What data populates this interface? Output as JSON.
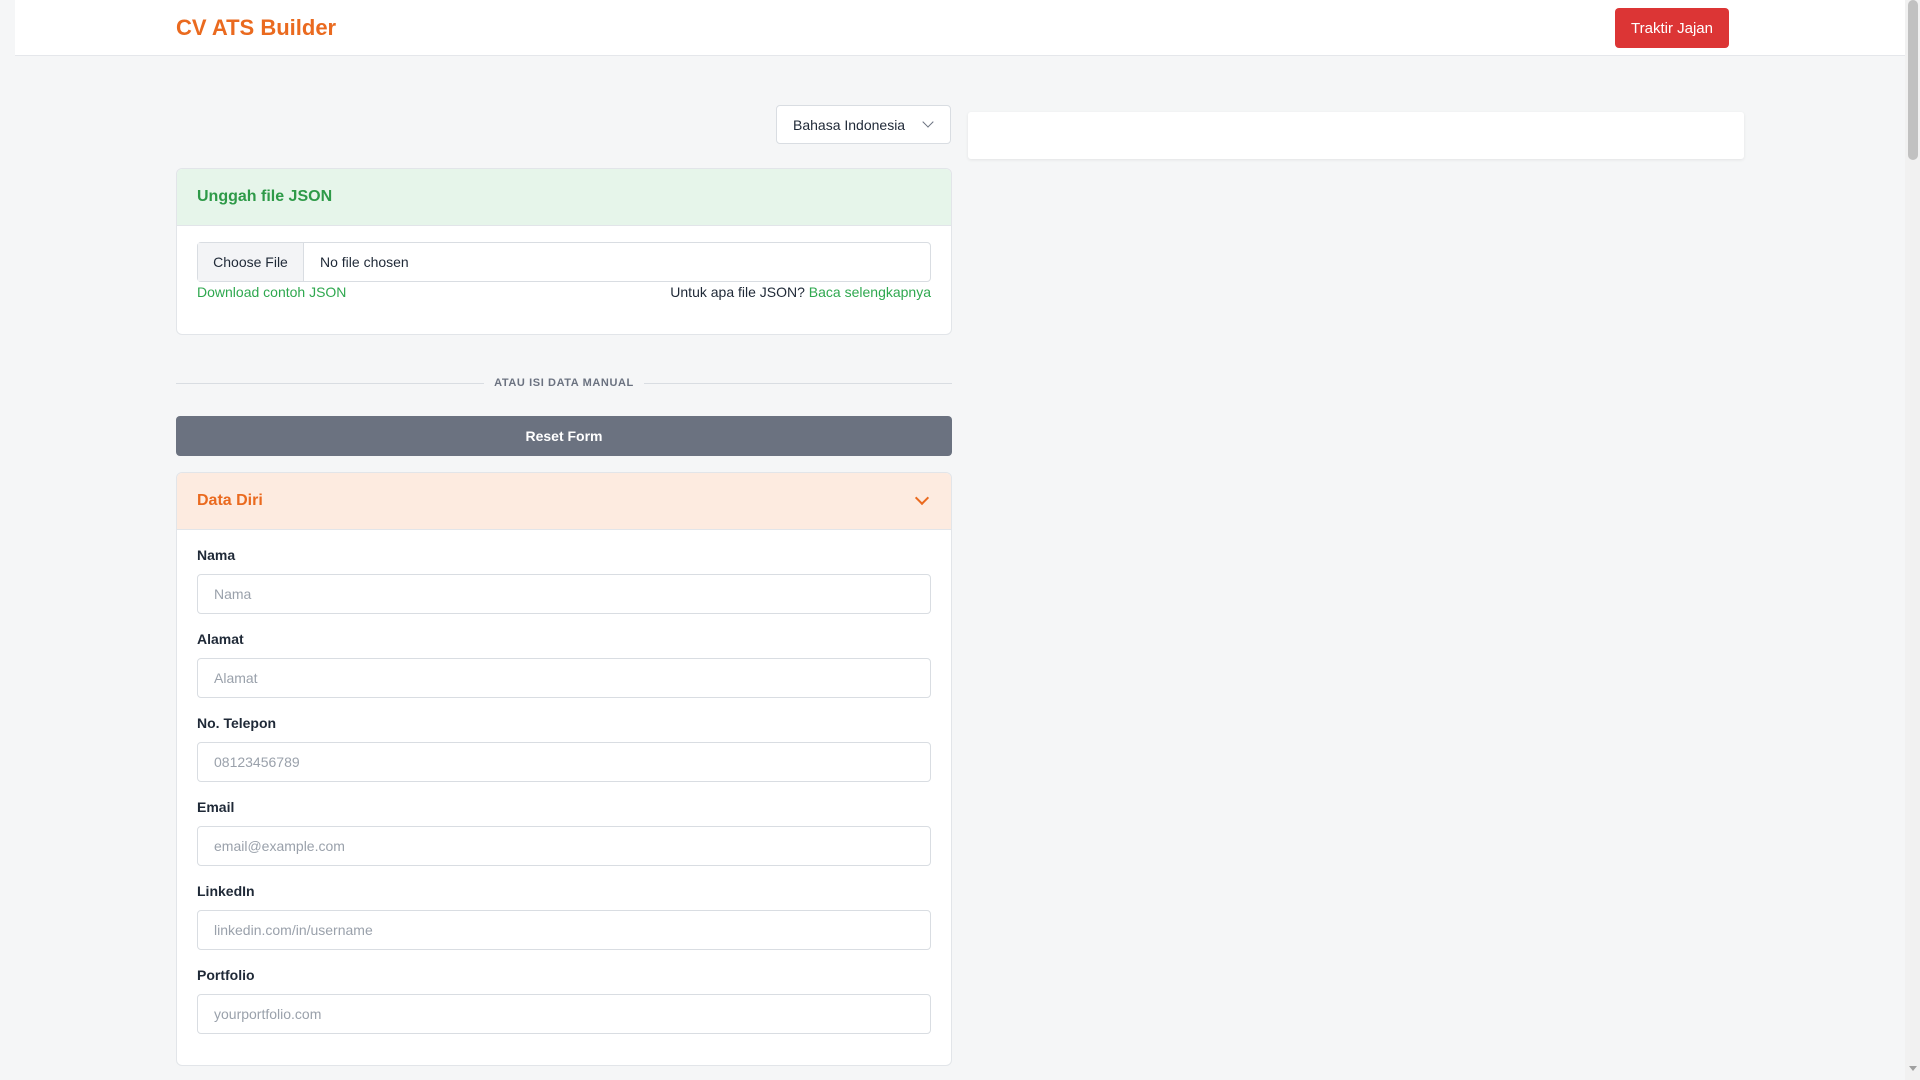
{
  "header": {
    "brand": "CV ATS Builder",
    "traktir_label": "Traktir Jajan"
  },
  "language": {
    "selected": "Bahasa Indonesia"
  },
  "upload": {
    "title": "Unggah file JSON",
    "choose_file": "Choose File",
    "no_file": "No file chosen",
    "download_link": "Download contoh JSON",
    "info_text": "Untuk apa file JSON?",
    "info_link": "Baca selengkapnya"
  },
  "divider_text": "ATAU ISI DATA MANUAL",
  "reset_label": "Reset Form",
  "data_diri": {
    "title": "Data Diri",
    "fields": [
      {
        "label": "Nama",
        "placeholder": "Nama"
      },
      {
        "label": "Alamat",
        "placeholder": "Alamat"
      },
      {
        "label": "No. Telepon",
        "placeholder": "08123456789"
      },
      {
        "label": "Email",
        "placeholder": "email@example.com"
      },
      {
        "label": "LinkedIn",
        "placeholder": "linkedin.com/in/username"
      },
      {
        "label": "Portfolio",
        "placeholder": "yourportfolio.com"
      }
    ]
  },
  "colors": {
    "brand": "#ea6a1f",
    "danger": "#dc3535",
    "success": "#2fa84f",
    "neutral_button": "#6b7280"
  }
}
